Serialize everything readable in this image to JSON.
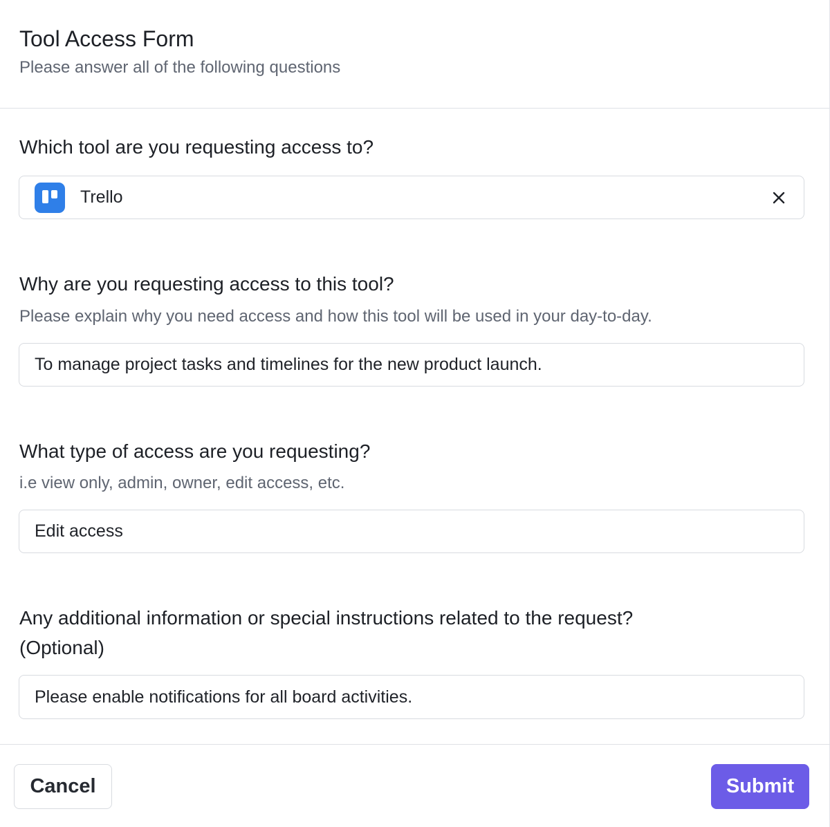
{
  "form": {
    "title": "Tool Access Form",
    "subtitle": "Please answer all of the following questions"
  },
  "questions": [
    {
      "label": "Which tool are you requesting access to?",
      "selected_tool": "Trello",
      "tool_icon": "trello-icon",
      "clear_icon": "close-icon"
    },
    {
      "label": "Why are you requesting access to this tool?",
      "helper": "Please explain why you need access and how this tool will be used in your day-to-day.",
      "value": "To manage project tasks and timelines for the new product launch."
    },
    {
      "label": "What type of access are you requesting?",
      "helper": "i.e view only, admin, owner, edit access, etc.",
      "value": "Edit access"
    },
    {
      "label_line1": "Any additional information or special instructions related to the request?",
      "label_line2": "(Optional)",
      "value": "Please enable notifications for all board activities."
    }
  ],
  "footer": {
    "cancel_label": "Cancel",
    "submit_label": "Submit"
  },
  "colors": {
    "accent": "#6c5ce7",
    "tool_brand": "#2f7fe8"
  }
}
